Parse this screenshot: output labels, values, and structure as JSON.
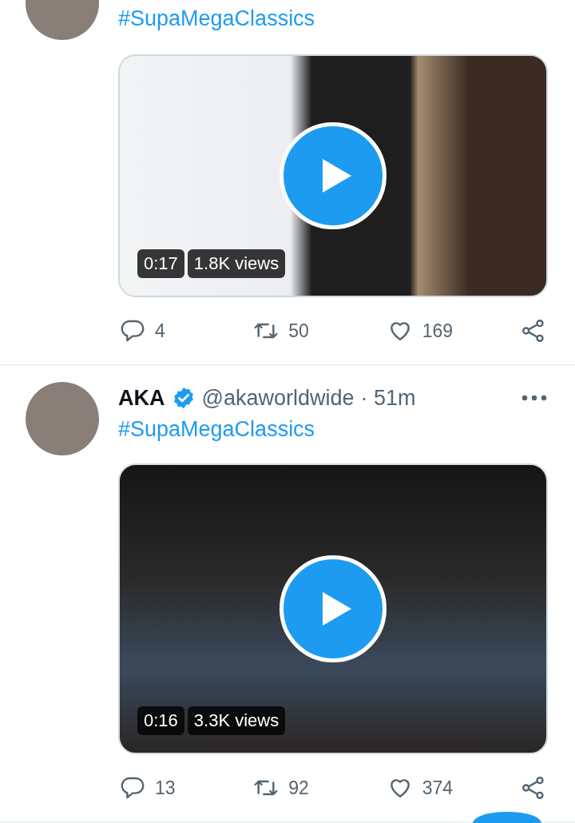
{
  "tweets": [
    {
      "text": "#SupaMegaClassics",
      "video": {
        "duration": "0:17",
        "views": "1.8K views"
      },
      "actions": {
        "replies": "4",
        "retweets": "50",
        "likes": "169"
      }
    },
    {
      "author": "AKA",
      "verified": true,
      "handle": "@akaworldwide",
      "time": "· 51m",
      "text": "#SupaMegaClassics",
      "video": {
        "duration": "0:16",
        "views": "3.3K views"
      },
      "actions": {
        "replies": "13",
        "retweets": "92",
        "likes": "374"
      }
    }
  ]
}
